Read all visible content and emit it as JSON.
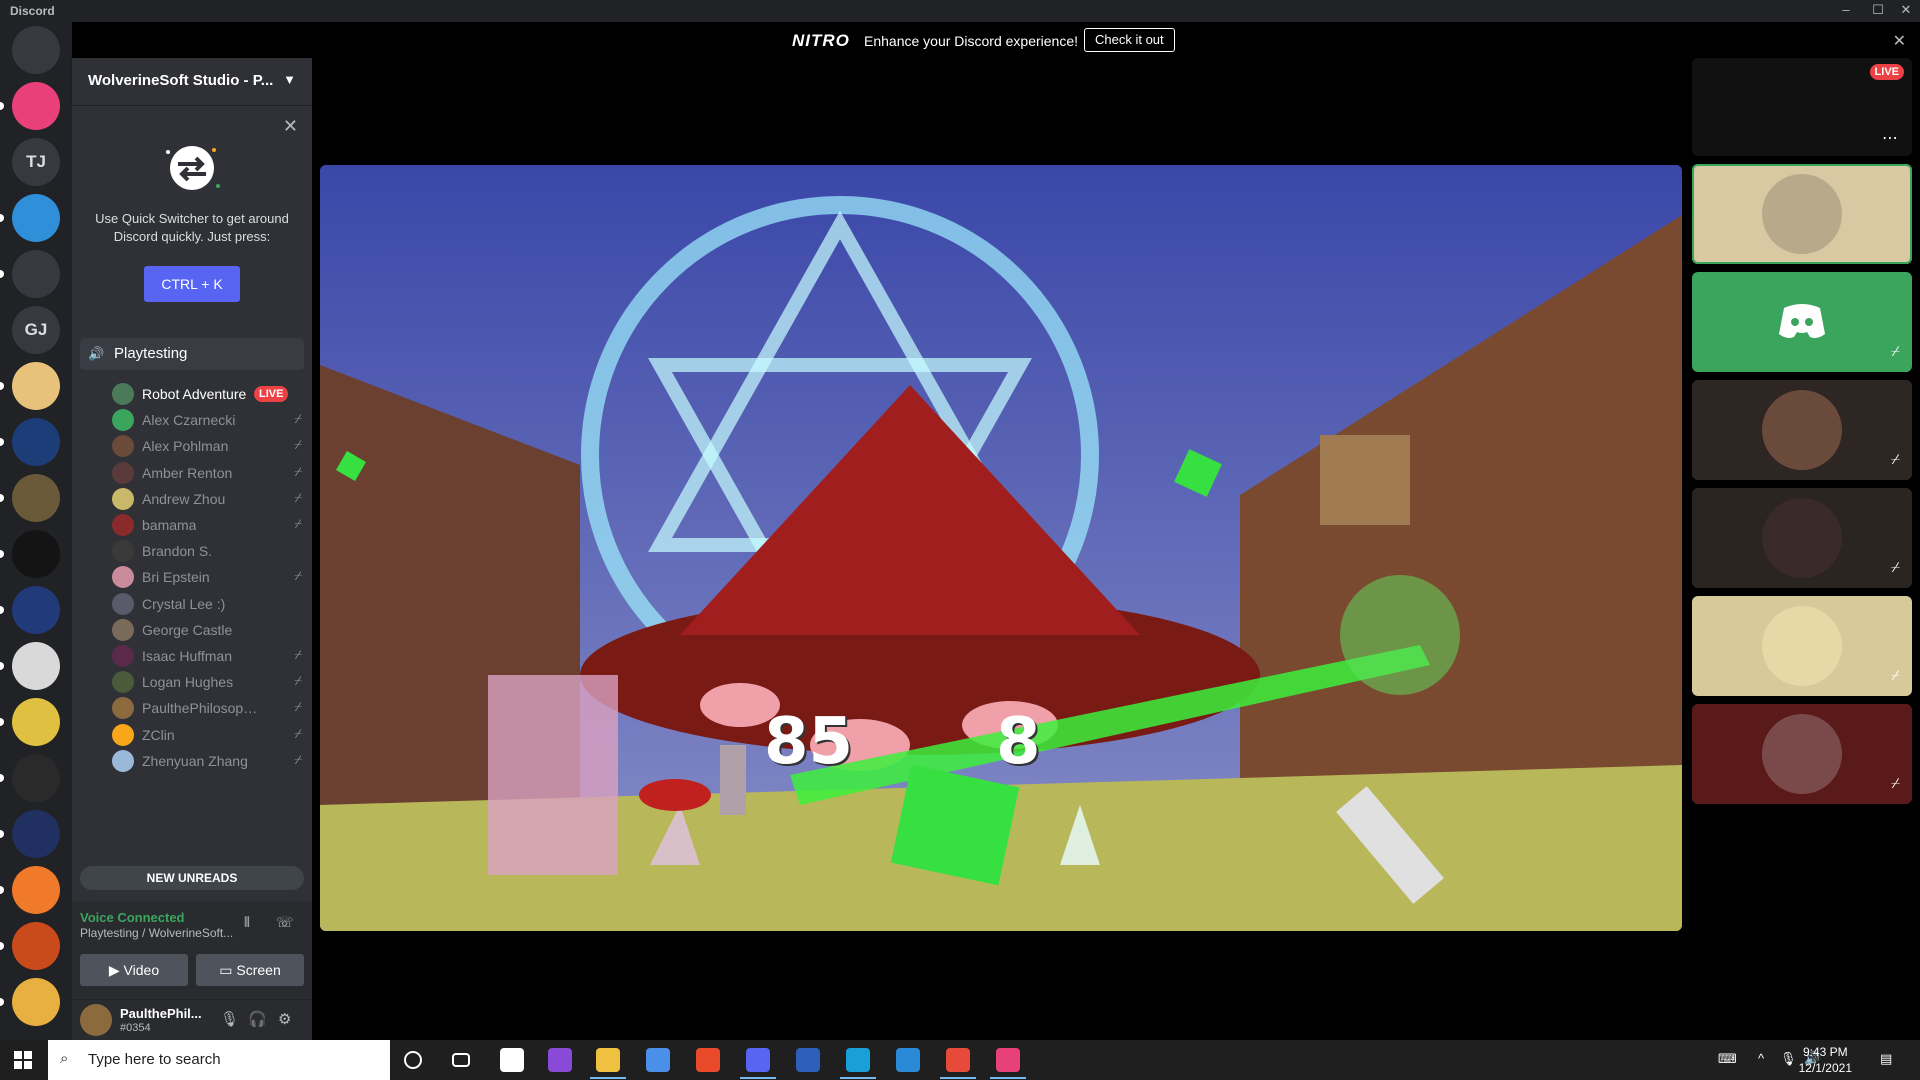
{
  "window": {
    "app_name": "Discord"
  },
  "nitro_banner": {
    "logo": "NITRO",
    "text": "Enhance your Discord experience!",
    "cta": "Check it out"
  },
  "guild_rail": {
    "items": [
      {
        "label": "",
        "icon": "discord-home-icon",
        "color": "#36393f"
      },
      {
        "label": "",
        "icon": "server-icon",
        "color": "#e9407a"
      },
      {
        "label": "TJ",
        "icon": "",
        "color": "#36393f"
      },
      {
        "label": "",
        "icon": "server-icon",
        "color": "#2f8fd8"
      },
      {
        "label": "",
        "icon": "gamepad-icon",
        "color": "#36393f"
      },
      {
        "label": "GJ",
        "icon": "",
        "color": "#36393f"
      },
      {
        "label": "",
        "icon": "server-icon",
        "color": "#e8c27a"
      },
      {
        "label": "",
        "icon": "server-icon",
        "color": "#1c3d78"
      },
      {
        "label": "",
        "icon": "server-icon",
        "color": "#6b5a3a"
      },
      {
        "label": "",
        "icon": "server-icon",
        "color": "#141414"
      },
      {
        "label": "",
        "icon": "server-icon",
        "color": "#203a7a"
      },
      {
        "label": "",
        "icon": "server-icon",
        "color": "#d9d9d9"
      },
      {
        "label": "",
        "icon": "server-icon",
        "color": "#e0c040"
      },
      {
        "label": "",
        "icon": "server-icon",
        "color": "#2a2a2a"
      },
      {
        "label": "",
        "icon": "server-icon",
        "color": "#203060"
      },
      {
        "label": "",
        "icon": "server-icon",
        "color": "#f07a2a"
      },
      {
        "label": "",
        "icon": "server-icon",
        "color": "#c94a1a"
      },
      {
        "label": "",
        "icon": "server-icon",
        "color": "#e8b040"
      }
    ]
  },
  "server": {
    "name": "WolverineSoft Studio - P..."
  },
  "quick_switcher": {
    "text": "Use Quick Switcher to get around Discord quickly. Just press:",
    "shortcut": "CTRL + K"
  },
  "voice_channel": {
    "name": "Playtesting",
    "users": [
      {
        "name": "Robot Adventure",
        "live": "LIVE",
        "muted": false,
        "active": true,
        "color": "#4a7a5a"
      },
      {
        "name": "Alex Czarnecki",
        "live": "",
        "muted": true,
        "active": false,
        "color": "#3ba55d"
      },
      {
        "name": "Alex Pohlman",
        "live": "",
        "muted": true,
        "active": false,
        "color": "#6b4a3a"
      },
      {
        "name": "Amber Renton",
        "live": "",
        "muted": true,
        "active": false,
        "color": "#5a3a3a"
      },
      {
        "name": "Andrew Zhou",
        "live": "",
        "muted": true,
        "active": false,
        "color": "#c9b86a"
      },
      {
        "name": "bamama",
        "live": "",
        "muted": true,
        "active": false,
        "color": "#8a2a2a"
      },
      {
        "name": "Brandon S.",
        "live": "",
        "muted": false,
        "active": false,
        "color": "#3a3a3a"
      },
      {
        "name": "Bri Epstein",
        "live": "",
        "muted": true,
        "active": false,
        "color": "#c98a9a"
      },
      {
        "name": "Crystal Lee :)",
        "live": "",
        "muted": false,
        "active": false,
        "color": "#5a5a6a"
      },
      {
        "name": "George Castle",
        "live": "",
        "muted": false,
        "active": false,
        "color": "#7a6a5a"
      },
      {
        "name": "Isaac Huffman",
        "live": "",
        "muted": true,
        "active": false,
        "color": "#5a2a4a"
      },
      {
        "name": "Logan Hughes",
        "live": "",
        "muted": true,
        "active": false,
        "color": "#4a5a3a"
      },
      {
        "name": "PaulthePhilosophy...",
        "live": "",
        "muted": true,
        "active": false,
        "color": "#8b6a3e"
      },
      {
        "name": "ZClin",
        "live": "",
        "muted": true,
        "active": false,
        "color": "#faa61a"
      },
      {
        "name": "Zhenyuan Zhang",
        "live": "",
        "muted": true,
        "active": false,
        "color": "#9ab8d8"
      }
    ]
  },
  "new_unreads": "NEW UNREADS",
  "voice_panel": {
    "status": "Voice Connected",
    "location": "Playtesting / WolverineSoft...",
    "video_label": "Video",
    "screen_label": "Screen"
  },
  "user_panel": {
    "name": "PaulthePhil...",
    "tag": "#0354"
  },
  "stream": {
    "hud_left": "85",
    "hud_right": "8"
  },
  "participants": {
    "live_badge": "LIVE",
    "tiles": [
      {
        "bg": "#111111",
        "avatar": "#3a3020",
        "muted": false,
        "highlight": false
      },
      {
        "bg": "#d8c9a3",
        "avatar": "#b7a98a",
        "muted": false,
        "highlight": true
      },
      {
        "bg": "#3ba55d",
        "avatar": "#3ba55d",
        "muted": true,
        "highlight": false
      },
      {
        "bg": "#2e2623",
        "avatar": "#6a4a3a",
        "muted": true,
        "highlight": false
      },
      {
        "bg": "#2b2522",
        "avatar": "#3a2a2a",
        "muted": true,
        "highlight": false
      },
      {
        "bg": "#d8c99a",
        "avatar": "#e8d8a8",
        "muted": true,
        "highlight": false
      },
      {
        "bg": "#5a1a1a",
        "avatar": "#7a4a4a",
        "muted": true,
        "highlight": false
      }
    ]
  },
  "taskbar": {
    "search_placeholder": "Type here to search",
    "time": "9:43 PM",
    "date": "12/1/2021"
  }
}
